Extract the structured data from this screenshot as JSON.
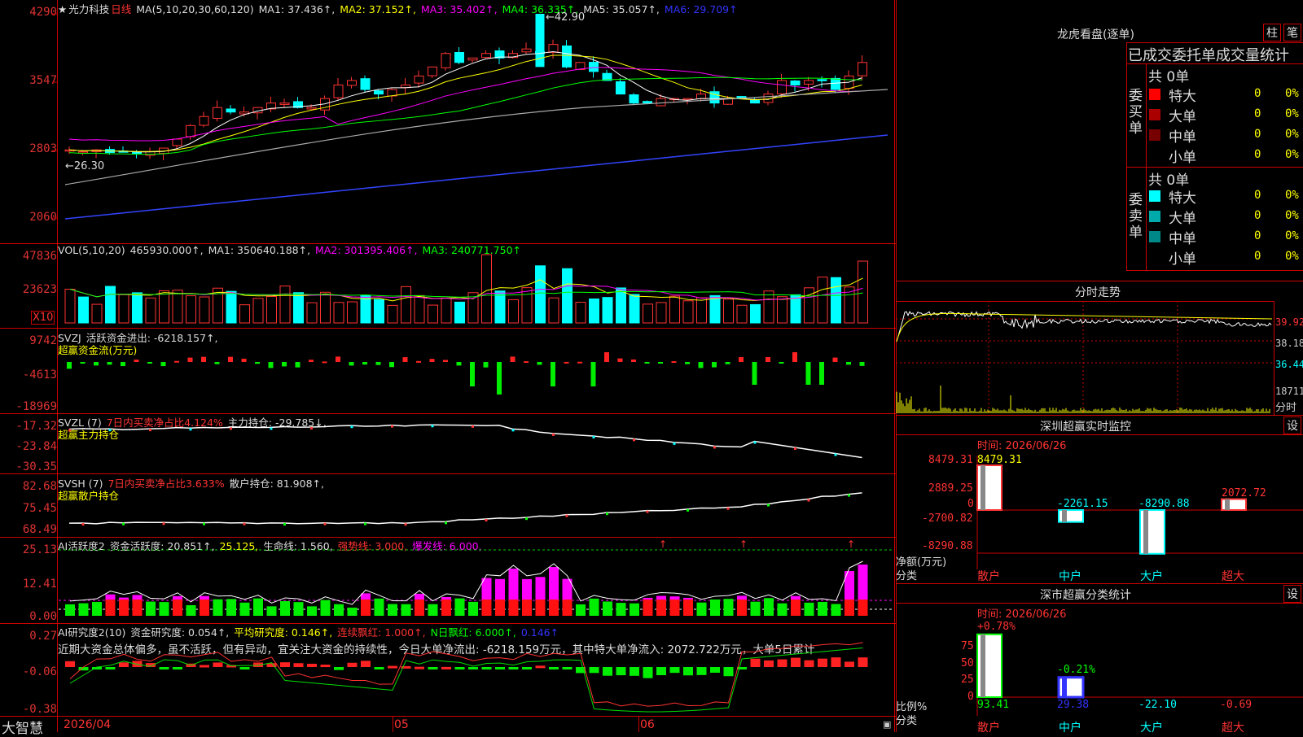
{
  "chart": {
    "stock_name": "光力科技",
    "period": "日线",
    "ma_label": "MA(5,10,20,30,60,120)",
    "ma1": "MA1: 37.436↑,",
    "ma2": "MA2: 37.152↑,",
    "ma3": "MA3: 35.402↑,",
    "ma4": "MA4: 36.335↑,",
    "ma5": "MA5: 35.057↑,",
    "ma6": "MA6: 29.709↑",
    "high_mark": "42.90",
    "low_mark": "←26.30",
    "y_labels": [
      "4290",
      "3547",
      "2803",
      "2060"
    ]
  },
  "vol": {
    "label": "VOL(5,10,20)",
    "value": "465930.000↑,",
    "ma1": "MA1: 350640.188↑,",
    "ma2": "MA2: 301395.406↑,",
    "ma3": "MA3: 240771.750↑",
    "y_labels": [
      "47836",
      "23623"
    ],
    "unit": "X10"
  },
  "svzj": {
    "label": "SVZJ",
    "text": "活跃资金进出: -6218.157↑,",
    "sub": "超赢资金流(万元)",
    "y_labels": [
      "9742",
      "-4613",
      "-18969"
    ]
  },
  "svzl": {
    "label": "SVZL (7)",
    "t1": "7日内买卖净占比4.124%",
    "t2": "主力持仓: -29.785↓,",
    "sub": "超赢主力持仓",
    "y_labels": [
      "-17.32",
      "-23.84",
      "-30.35"
    ]
  },
  "svsh": {
    "label": "SVSH (7)",
    "t1": "7日内买卖净占比3.633%",
    "t2": "散户持仓: 81.908↑,",
    "sub": "超赢散户持仓",
    "y_labels": [
      "82.68",
      "75.45",
      "68.49"
    ]
  },
  "ai1": {
    "label": "AI活跃度2",
    "t1": "资金活跃度: 20.851↑,",
    "t2": "25.125,",
    "t3": "生命线: 1.560,",
    "t4": "强势线: 3.000,",
    "t5": "爆发线: 6.000,",
    "y_labels": [
      "25.13",
      "12.41",
      "0.00"
    ]
  },
  "ai2": {
    "label": "AI研究度2(10)",
    "t1": "资金研究度: 0.054↑,",
    "t2": "平均研究度: 0.146↑,",
    "t3": "连续飘红: 1.000↑,",
    "t4": "N日飘红: 6.000↑,",
    "t5": "0.146↑",
    "note": "近期大资金总体偏多，虽不活跃，但有异动，宜关注大资金的持续性，今日大单净流出: -6218.159万元，其中特大单净流入: 2072.722万元，大单5日累计",
    "y_labels": [
      "0.27",
      "-0.06",
      "-0.38"
    ]
  },
  "xaxis": {
    "d1": "2026/04",
    "d2": "05",
    "d3": "06",
    "brand": "大智慧"
  },
  "lhb": {
    "title": "龙虎看盘(逐单)",
    "btn1": "柱",
    "btn2": "笔",
    "sub": "已成交委托单成交量统计",
    "buy_group": "委买单",
    "sell_group": "委卖单",
    "buy_total": "共 0单",
    "sell_total": "共 0单",
    "buy_rows": [
      {
        "name": "特大",
        "count": "0",
        "pct": "0%",
        "color": "#ff0000"
      },
      {
        "name": "大单",
        "count": "0",
        "pct": "0%",
        "color": "#aa0000"
      },
      {
        "name": "中单",
        "count": "0",
        "pct": "0%",
        "color": "#770000"
      },
      {
        "name": "小单",
        "count": "0",
        "pct": "0%",
        "color": "#000000"
      }
    ],
    "sell_rows": [
      {
        "name": "特大",
        "count": "0",
        "pct": "0%",
        "color": "#00ffff"
      },
      {
        "name": "大单",
        "count": "0",
        "pct": "0%",
        "color": "#00aaaa"
      },
      {
        "name": "中单",
        "count": "0",
        "pct": "0%",
        "color": "#008888"
      },
      {
        "name": "小单",
        "count": "0",
        "pct": "0%",
        "color": "#000000"
      }
    ]
  },
  "fenshi": {
    "title": "分时走势",
    "y1": "39.92",
    "y2": "38.18",
    "y3": "36.44",
    "y4": "18711",
    "y5": "分时"
  },
  "sz_monitor": {
    "title": "深圳超赢实时监控",
    "btn": "设",
    "time": "时间: 2026/06/26",
    "ylabels": [
      "8479.31",
      "2889.25",
      "0",
      "-2700.82",
      "-8290.88"
    ],
    "unit1": "净额(万元)",
    "unit2": "分类",
    "cats": [
      "散户",
      "中户",
      "大户",
      "超大"
    ],
    "values": [
      "8479.31",
      "-2261.15",
      "-8290.88",
      "2072.72"
    ]
  },
  "sz_class": {
    "title": "深市超赢分类统计",
    "btn": "设",
    "time": "时间: 2026/06/26",
    "ylabels": [
      "75",
      "50",
      "25",
      "0"
    ],
    "unit1": "比例%",
    "unit2": "分类",
    "cats": [
      "散户",
      "中户",
      "大户",
      "超大"
    ],
    "top1": "+0.78%",
    "top2": "-0.21%",
    "values": [
      "93.41",
      "29.38",
      "-22.10",
      "-0.69"
    ]
  }
}
